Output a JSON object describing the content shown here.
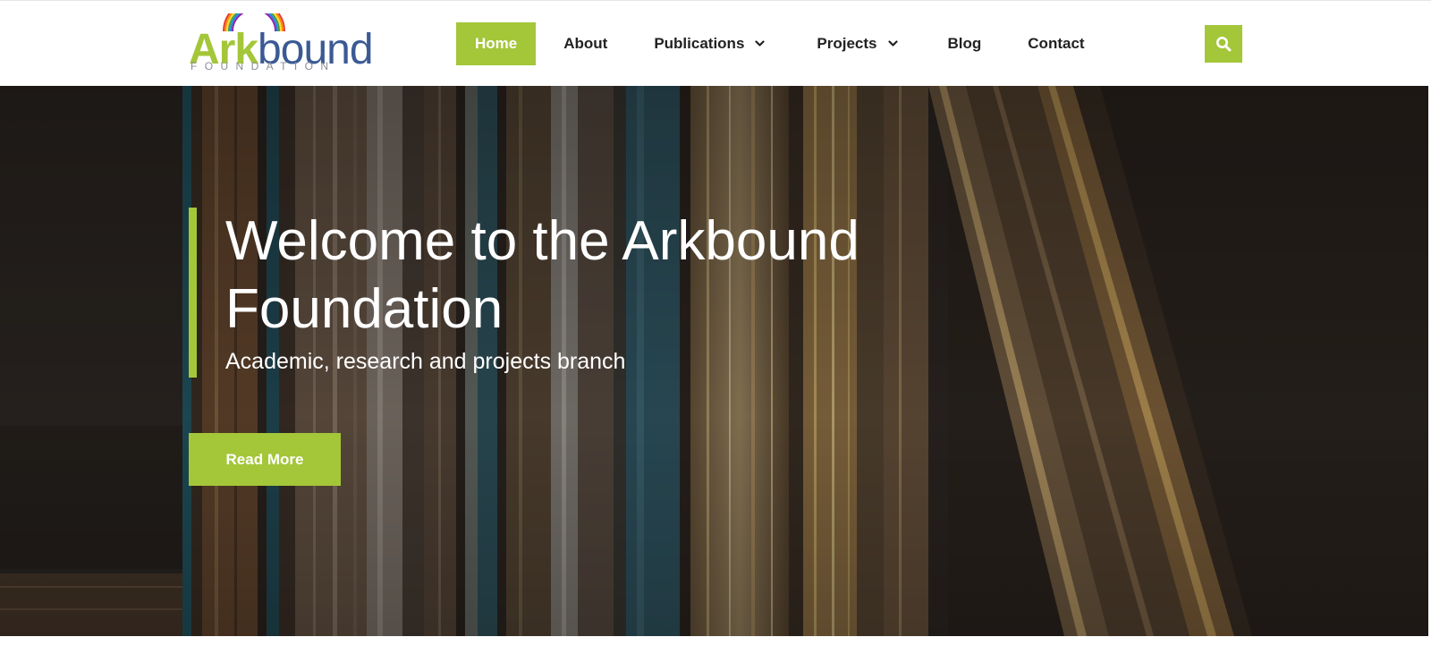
{
  "logo": {
    "word_green": "Ark",
    "word_blue": "bound",
    "subtitle": "FOUNDATION",
    "arc_icon": "rainbow-arc-icon"
  },
  "nav": {
    "items": [
      {
        "label": "Home",
        "active": true
      },
      {
        "label": "About"
      },
      {
        "label": "Publications",
        "has_dropdown": true
      },
      {
        "label": "Projects",
        "has_dropdown": true
      },
      {
        "label": "Blog"
      },
      {
        "label": "Contact"
      }
    ],
    "dropdown_icon": "chevron-down-icon",
    "search_icon": "search-icon"
  },
  "hero": {
    "title": "Welcome to the Arkbound Foundation",
    "subtitle": "Academic, research and projects branch",
    "button_label": "Read More",
    "background": "books-photo"
  },
  "colors": {
    "accent": "#a4c639",
    "brand_blue": "#3b5a94",
    "nav_text": "#222222",
    "hero_text": "#ffffff"
  }
}
